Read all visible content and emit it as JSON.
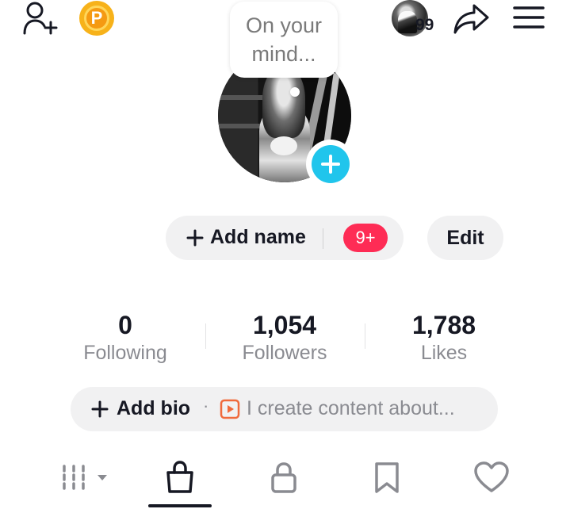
{
  "top_bar": {
    "add_friend_icon": "person-plus-icon",
    "points_icon": "coin-p-icon",
    "points_letter": "P",
    "story_views_count": "99",
    "share_icon": "share-arrow-icon",
    "menu_icon": "hamburger-menu-icon"
  },
  "thought_bubble": {
    "text": "On your mind..."
  },
  "profile": {
    "add_photo_icon": "plus-icon",
    "add_name_label": "Add name",
    "notification_badge": "9+",
    "edit_label": "Edit"
  },
  "stats": [
    {
      "value": "0",
      "label": "Following"
    },
    {
      "value": "1,054",
      "label": "Followers"
    },
    {
      "value": "1,788",
      "label": "Likes"
    }
  ],
  "bio": {
    "add_bio_label": "Add bio",
    "separator": "·",
    "placeholder": "I create content about..."
  },
  "tabs": [
    {
      "icon": "grid-filter-icon",
      "active": false
    },
    {
      "icon": "shopping-bag-icon",
      "active": true
    },
    {
      "icon": "lock-icon",
      "active": false
    },
    {
      "icon": "bookmark-icon",
      "active": false
    },
    {
      "icon": "heart-icon",
      "active": false
    }
  ],
  "colors": {
    "accent_cyan": "#20C5EC",
    "badge_red": "#FE2C55",
    "coin_gold": "#F7B21A",
    "pill_bg": "#F1F1F2",
    "muted_text": "#8A8B91",
    "bio_play_orange": "#F06A3C"
  }
}
